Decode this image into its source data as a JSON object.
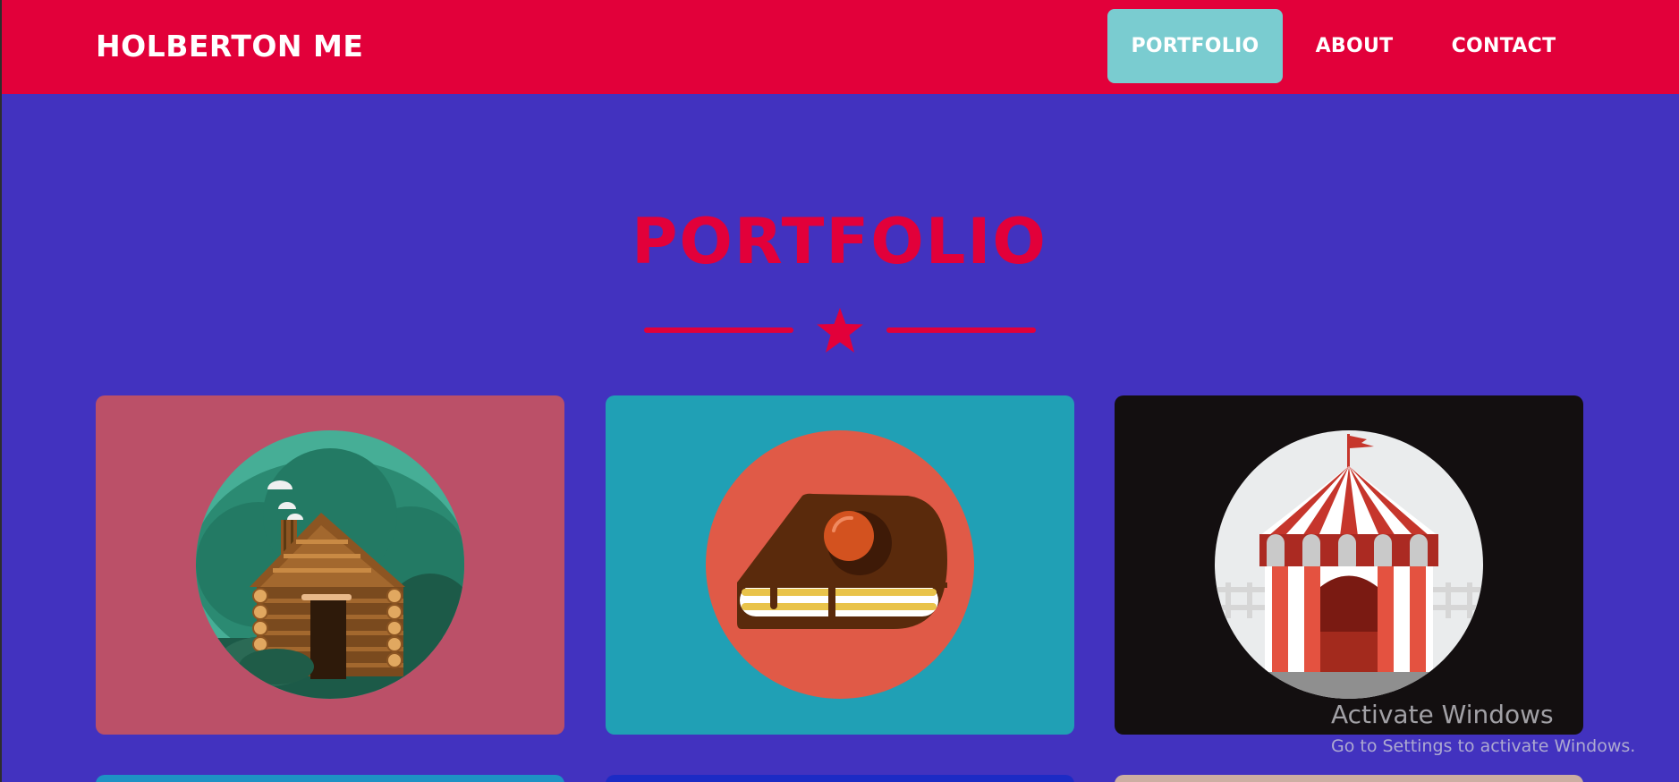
{
  "header": {
    "brand": "HOLBERTON ME",
    "nav": [
      {
        "label": "PORTFOLIO",
        "active": true
      },
      {
        "label": "ABOUT",
        "active": false
      },
      {
        "label": "CONTACT",
        "active": false
      }
    ]
  },
  "portfolio": {
    "title": "PORTFOLIO",
    "divider_icon": "star-icon",
    "items": [
      {
        "image": "log-cabin-illustration",
        "background": "#bb5068"
      },
      {
        "image": "cake-slice-illustration",
        "background": "#20a0b5"
      },
      {
        "image": "circus-tent-illustration",
        "background": "#130f10"
      },
      {
        "image": "",
        "background": "#1d92c4"
      },
      {
        "image": "",
        "background": "#1c2bc5"
      },
      {
        "image": "",
        "background": "#ccaea2"
      }
    ]
  },
  "system_overlay": {
    "title": "Activate Windows",
    "subtitle": "Go to Settings to activate Windows."
  },
  "colors": {
    "page_background": "#4232bf",
    "header_background": "#e2003a",
    "accent": "#e2003a",
    "active_nav": "#7accd0"
  }
}
